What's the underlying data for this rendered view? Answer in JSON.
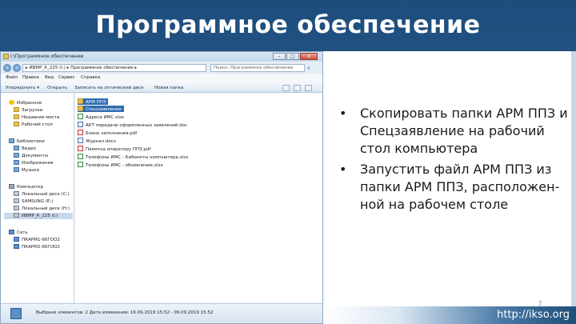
{
  "slide": {
    "title": "Программное обеспечение",
    "bullets": [
      "Скопировать папки АРМ ППЗ и Спецзаявление на рабочий стол компьютера",
      "Запустить файл АРМ ППЗ из папки АРМ ППЗ, расположен­ной на рабочем столе"
    ],
    "footer_url": "http://ikso.org",
    "page_number": "7"
  },
  "window": {
    "title": "I:\\Программное обеспечение",
    "address": "▸ ИВМР_К_225 (I:) ▸ Программное обеспечение ▸",
    "search_placeholder": "Поиск: Программное обеспечение",
    "controls": {
      "minimize": "–",
      "maximize": "□",
      "close": "x"
    },
    "menu": [
      "Файл",
      "Правка",
      "Вид",
      "Сервис",
      "Справка"
    ],
    "toolbar": [
      "Упорядочить ▾",
      "Открыть",
      "Записать на оптический диск",
      "Новая папка"
    ],
    "nav": [
      {
        "label": "Избранное",
        "icon": "star-icon"
      },
      {
        "label": "Загрузки",
        "icon": "folder-icon"
      },
      {
        "label": "Недавние места",
        "icon": "folder-icon"
      },
      {
        "label": "Рабочий стол",
        "icon": "folder-icon"
      },
      {
        "label": "Библиотеки",
        "icon": "library-icon"
      },
      {
        "label": "Видео",
        "icon": "library-icon"
      },
      {
        "label": "Документы",
        "icon": "library-icon"
      },
      {
        "label": "Изображения",
        "icon": "library-icon"
      },
      {
        "label": "Музыка",
        "icon": "library-icon"
      },
      {
        "label": "Компьютер",
        "icon": "computer-icon"
      },
      {
        "label": "Локальный диск (C:)",
        "icon": "drive-icon"
      },
      {
        "label": "SAMSUNG (E:)",
        "icon": "drive-icon"
      },
      {
        "label": "Локальный диск (H:)",
        "icon": "drive-icon"
      },
      {
        "label": "ИВМР_К_225 (I:)",
        "icon": "drive-icon"
      },
      {
        "label": "Сеть",
        "icon": "network-icon"
      },
      {
        "label": "ПКАРМ1-66ГОО2",
        "icon": "network-icon"
      },
      {
        "label": "ПКАРМ2-66ГОО2",
        "icon": "network-icon"
      }
    ],
    "files": [
      {
        "name": "АРМ ППЗ",
        "icon": "folder-icon"
      },
      {
        "name": "Спецзаявление",
        "icon": "folder-icon"
      },
      {
        "name": "Адреса ИМС.xlsx",
        "icon": "excel-file-icon"
      },
      {
        "name": "АКТ передачи оформленных заявлений.doc",
        "icon": "word-file-icon"
      },
      {
        "name": "Бланк заполнения.pdf",
        "icon": "pdf-file-icon"
      },
      {
        "name": "Журнал.docx",
        "icon": "word-file-icon"
      },
      {
        "name": "Памятка оператору ППЗ.pdf",
        "icon": "pdf-file-icon"
      },
      {
        "name": "Телефоны ИМС - Кабинеты компьютера.xlsx",
        "icon": "excel-file-icon"
      },
      {
        "name": "Телефоны ИМС - обновление.xlsx",
        "icon": "excel-file-icon"
      }
    ],
    "status": "Выбрано элементов: 2  Дата изменения: 16.09.2019 15:52 - 09.09.2019 15:52"
  }
}
